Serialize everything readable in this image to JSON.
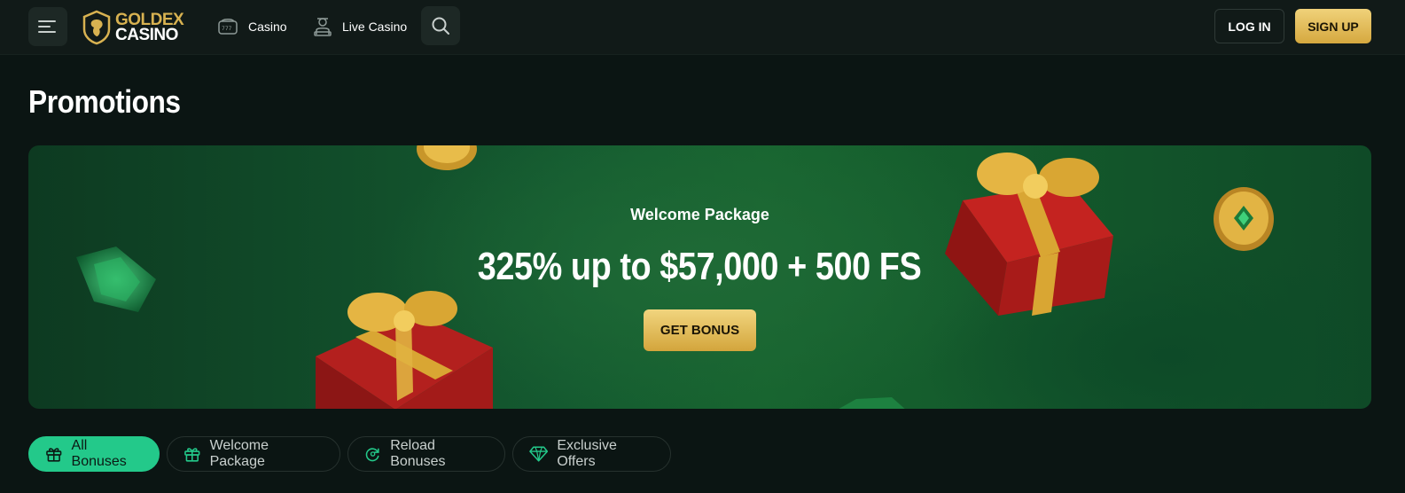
{
  "header": {
    "logo_top": "GOLDEX",
    "logo_bottom": "CASINO",
    "nav": [
      {
        "label": "Casino",
        "icon": "slot-machine-icon"
      },
      {
        "label": "Live Casino",
        "icon": "dealer-icon"
      }
    ],
    "login_label": "LOG IN",
    "signup_label": "SIGN UP"
  },
  "page": {
    "title": "Promotions"
  },
  "banner": {
    "subtitle": "Welcome Package",
    "headline": "325% up to $57,000 + 500 FS",
    "cta_label": "GET BONUS"
  },
  "tabs": [
    {
      "label": "All Bonuses",
      "icon": "gift-icon",
      "active": true
    },
    {
      "label": "Welcome Package",
      "icon": "gift-icon",
      "active": false
    },
    {
      "label": "Reload Bonuses",
      "icon": "reload-icon",
      "active": false
    },
    {
      "label": "Exclusive Offers",
      "icon": "diamond-icon",
      "active": false
    }
  ],
  "colors": {
    "accent_gold": "#d8b251",
    "accent_green": "#23c98a",
    "background": "#0b1513",
    "banner_green": "#17642f"
  }
}
